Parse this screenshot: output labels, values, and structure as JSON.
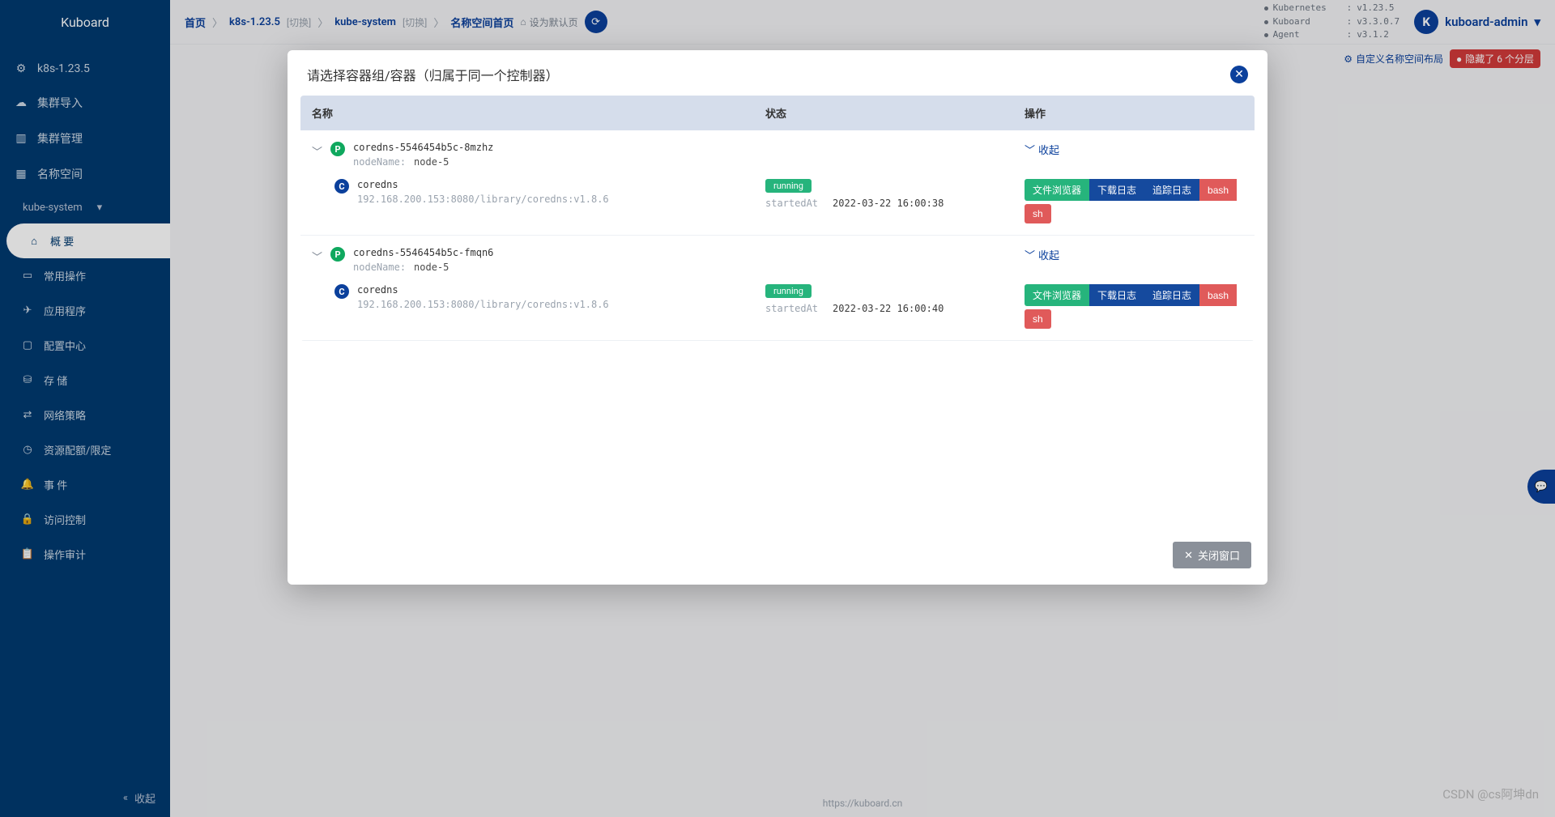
{
  "app": {
    "logo": "Kuboard"
  },
  "sidebar": {
    "cluster": "k8s-1.23.5",
    "items": [
      {
        "label": "集群导入"
      },
      {
        "label": "集群管理"
      },
      {
        "label": "名称空间"
      }
    ],
    "namespace": "kube-system",
    "sub_items": [
      {
        "label": "概 要",
        "active": true
      },
      {
        "label": "常用操作"
      },
      {
        "label": "应用程序"
      },
      {
        "label": "配置中心"
      },
      {
        "label": "存 储"
      },
      {
        "label": "网络策略"
      },
      {
        "label": "资源配额/限定"
      },
      {
        "label": "事 件"
      },
      {
        "label": "访问控制"
      },
      {
        "label": "操作审计"
      }
    ],
    "collapse": "收起"
  },
  "breadcrumb": {
    "home": "首页",
    "cluster": "k8s-1.23.5",
    "switch": "[切换]",
    "namespace": "kube-system",
    "page": "名称空间首页",
    "set_default": "设为默认页"
  },
  "versions": {
    "k8s_label": "Kubernetes",
    "k8s_val": "v1.23.5",
    "kuboard_label": "Kuboard",
    "kuboard_val": "v3.3.0.7",
    "agent_label": "Agent",
    "agent_val": "v3.1.2"
  },
  "user": {
    "initial": "K",
    "name": "kuboard-admin"
  },
  "subheader": {
    "custom_layout": "自定义名称空间布局",
    "hidden_layers": "隐藏了 6 个分层"
  },
  "footer": {
    "url": "https://kuboard.cn"
  },
  "watermark": "CSDN @cs阿坤dn",
  "modal": {
    "title": "请选择容器组/容器（归属于同一个控制器）",
    "columns": {
      "name": "名称",
      "status": "状态",
      "action": "操作"
    },
    "collapse": "收起",
    "close_window": "关闭窗口",
    "pods": [
      {
        "name": "coredns-5546454b5c-8mzhz",
        "node_label": "nodeName:",
        "node": "node-5",
        "containers": [
          {
            "name": "coredns",
            "image": "192.168.200.153:8080/library/coredns:v1.8.6",
            "status": "running",
            "started_label": "startedAt",
            "started_at": "2022-03-22 16:00:38"
          }
        ]
      },
      {
        "name": "coredns-5546454b5c-fmqn6",
        "node_label": "nodeName:",
        "node": "node-5",
        "containers": [
          {
            "name": "coredns",
            "image": "192.168.200.153:8080/library/coredns:v1.8.6",
            "status": "running",
            "started_label": "startedAt",
            "started_at": "2022-03-22 16:00:40"
          }
        ]
      }
    ],
    "actions": {
      "file_browser": "文件浏览器",
      "download_log": "下载日志",
      "trace_log": "追踪日志",
      "bash": "bash",
      "sh": "sh"
    }
  }
}
